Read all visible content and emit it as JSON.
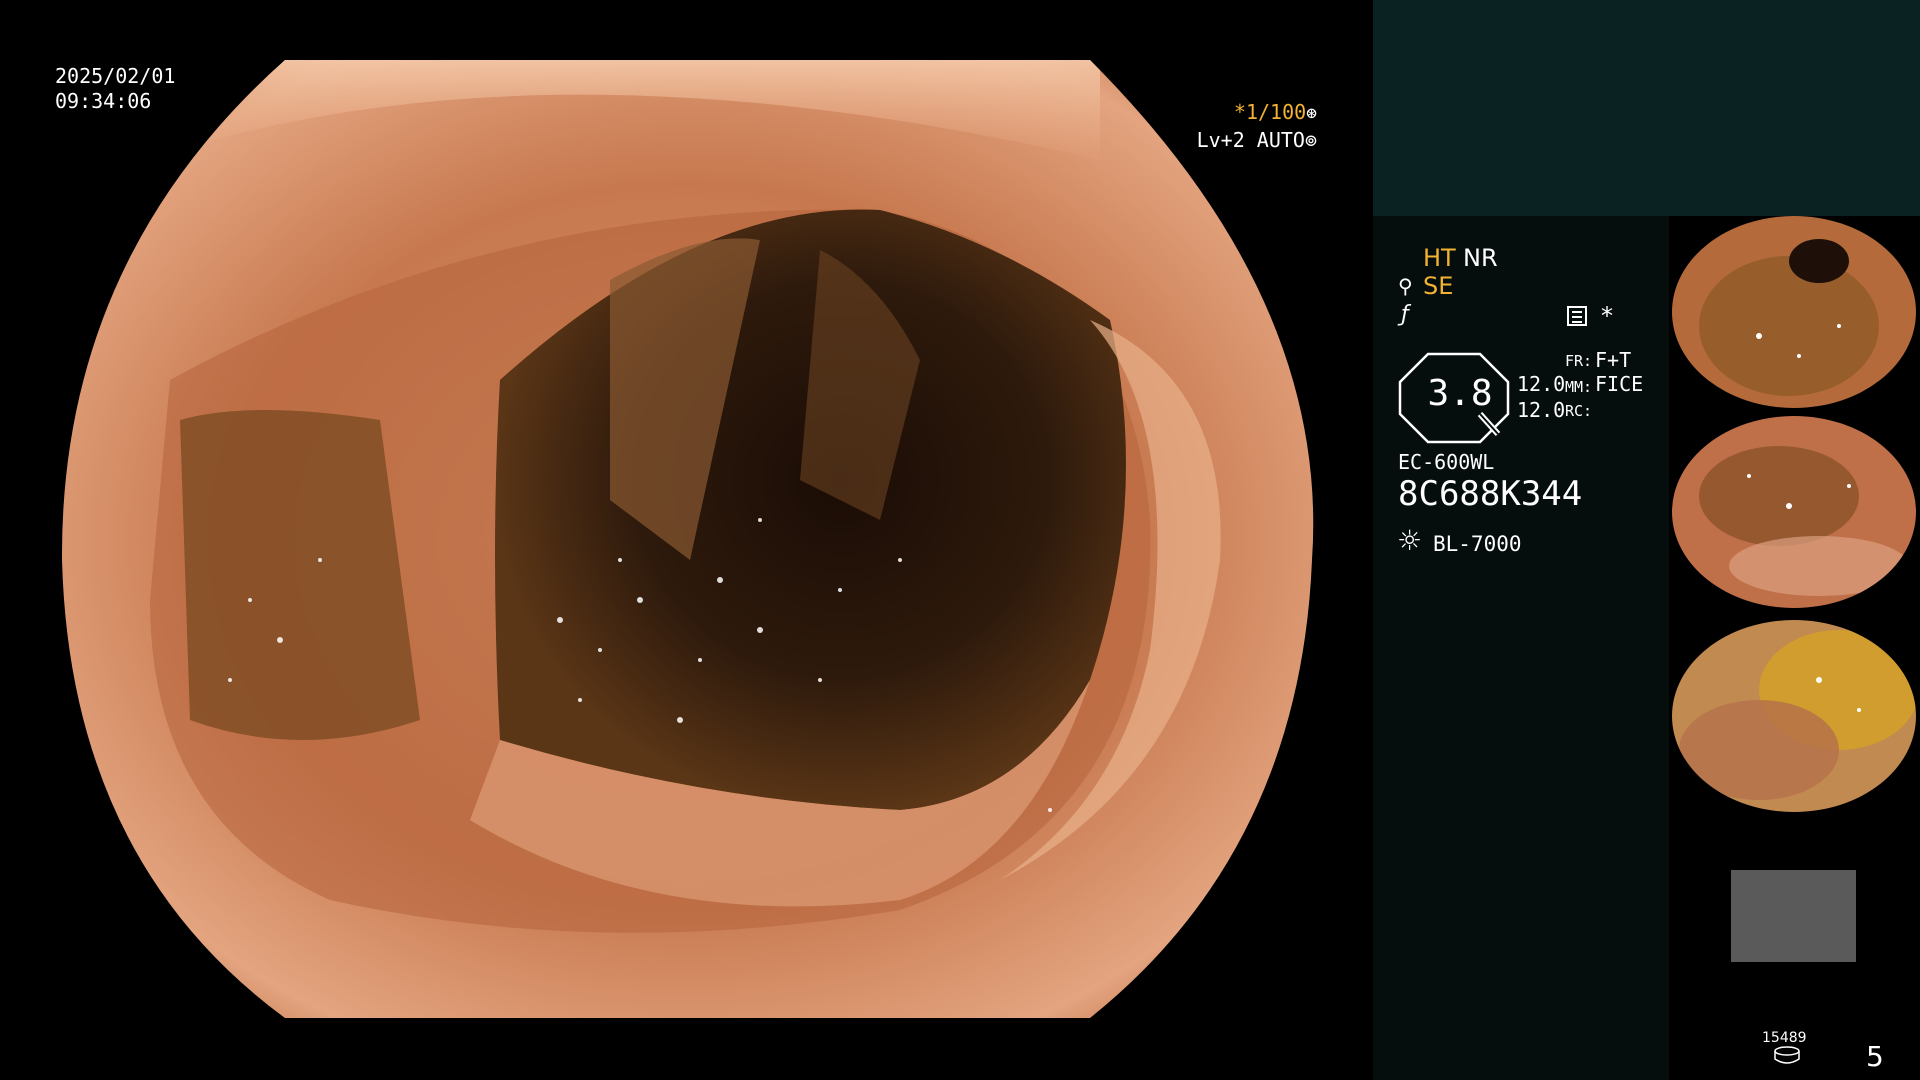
{
  "overlay": {
    "date": "2025/02/01",
    "time": "09:34:06",
    "shutter": "*1/100",
    "shutter_icon": "aperture-icon",
    "iris": "Lv+2 AUTO",
    "iris_icon": "iris-icon"
  },
  "status": {
    "ht": "HT",
    "nr": "NR",
    "se": "SE",
    "se_icon": "wand-icon",
    "f_icon": "f-icon",
    "menu_icon": "settings-list-icon",
    "star": "*"
  },
  "zoom": {
    "value": "3.8",
    "v1": "12.0",
    "v2": "12.0",
    "fr_label": "FR:",
    "mm_label": "MM:",
    "rc_label": "RC:",
    "fr_value": "F+T",
    "mm_value": "FICE"
  },
  "device": {
    "model": "EC-600WL",
    "serial": "8C688K344",
    "light_icon": "sun-icon",
    "light": "BL-7000"
  },
  "thumbnails": [
    {
      "name": "capture-1",
      "tint": "#b46a3a"
    },
    {
      "name": "capture-2",
      "tint": "#c07048"
    },
    {
      "name": "capture-3",
      "tint": "#c29a40"
    }
  ],
  "footer": {
    "count": "15489",
    "disk_icon": "disk-icon",
    "page": "5"
  },
  "colors": {
    "accent": "#f2b233",
    "panel_top": "#0a2222",
    "panel": "#050d0d"
  }
}
